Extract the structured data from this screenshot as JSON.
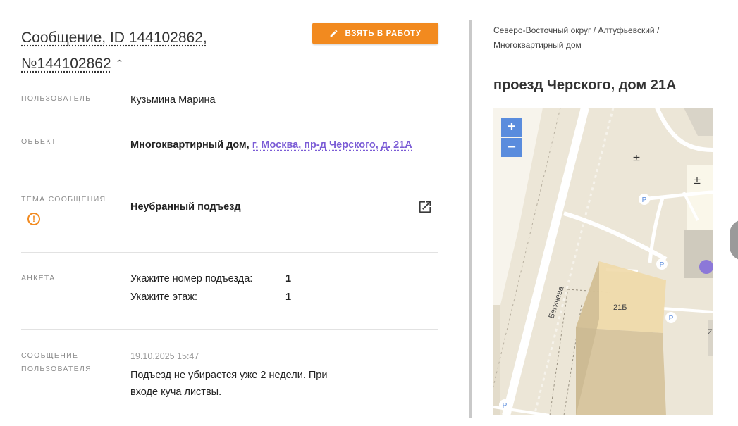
{
  "message": {
    "title_line1": "Сообщение, ID 144102862,",
    "title_line2": "№144102862",
    "chevron": "^",
    "take_button_label": "ВЗЯТЬ В РАБОТУ",
    "take_button_icon": "pencil-icon"
  },
  "fields": {
    "user_label": "ПОЛЬЗОВАТЕЛЬ",
    "user_value": "Кузьмина Марина",
    "object_label": "ОБЪЕКТ",
    "object_type": "Многоквартирный дом,",
    "object_address": "г. Москва, пр-д Черского, д. 21А",
    "topic_label": "ТЕМА СООБЩЕНИЯ",
    "topic_value": "Неубранный подъезд",
    "topic_warning_icon": "!",
    "survey_label": "АНКЕТА",
    "survey": [
      {
        "question": "Укажите номер подъезда:",
        "answer": "1"
      },
      {
        "question": "Укажите этаж:",
        "answer": "1"
      }
    ],
    "user_message_label_line1": "СООБЩЕНИЕ",
    "user_message_label_line2": "ПОЛЬЗОВАТЕЛЯ",
    "user_message_time": "19.10.2025 15:47",
    "user_message_text": "Подъезд не убирается уже 2 недели. При входе куча листвы."
  },
  "location": {
    "breadcrumb": "Северо-Восточный округ / Алтуфьевский / Многоквартирный дом",
    "address": "проезд Черского, дом 21А"
  },
  "map": {
    "zoom_in": "+",
    "zoom_out": "−",
    "street_label": "Бегичева",
    "building_label": "21Б",
    "parking_symbol": "P",
    "poi_symbol": "±",
    "building_fragment": "Z"
  },
  "colors": {
    "accent": "#f28a1f",
    "link": "#7b5cd6",
    "zoom": "#5a8cdd",
    "map_base": "#ece6d7",
    "building_highlight": "#f0d9a8"
  }
}
